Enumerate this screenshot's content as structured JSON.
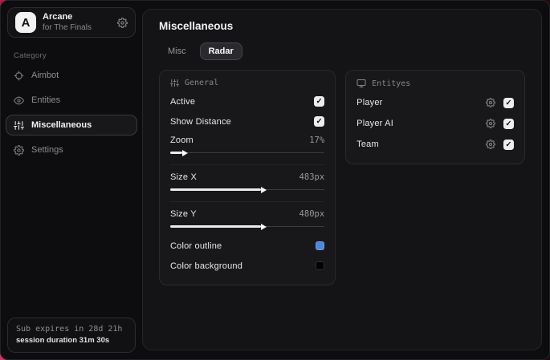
{
  "brand": {
    "logo_letter": "A",
    "title": "Arcane",
    "subtitle": "for The Finals"
  },
  "sidebar": {
    "category_label": "Category",
    "items": [
      {
        "label": "Aimbot"
      },
      {
        "label": "Entities"
      },
      {
        "label": "Miscellaneous"
      },
      {
        "label": "Settings"
      }
    ],
    "subscription": {
      "expires": "Sub expires in 28d 21h",
      "session": "session duration 31m 30s"
    }
  },
  "main": {
    "title": "Miscellaneous",
    "tabs": [
      {
        "label": "Misc"
      },
      {
        "label": "Radar"
      }
    ],
    "general": {
      "title": "General",
      "toggles": [
        {
          "label": "Active",
          "checked": true
        },
        {
          "label": "Show Distance",
          "checked": true
        }
      ],
      "sliders": [
        {
          "label": "Zoom",
          "value": "17%",
          "percent": 8
        },
        {
          "label": "Size X",
          "value": "483px",
          "percent": 59
        },
        {
          "label": "Size Y",
          "value": "480px",
          "percent": 59
        }
      ],
      "colors": [
        {
          "label": "Color outline",
          "swatch": "#4f86dd"
        },
        {
          "label": "Color background",
          "swatch": "#000000"
        }
      ]
    },
    "entities": {
      "title": "Entityes",
      "rows": [
        {
          "label": "Player",
          "checked": true
        },
        {
          "label": "Player AI",
          "checked": true
        },
        {
          "label": "Team",
          "checked": true
        }
      ]
    }
  },
  "theme": {
    "accent_red": "#c21a4b",
    "swatch_blue": "#4f86dd"
  }
}
